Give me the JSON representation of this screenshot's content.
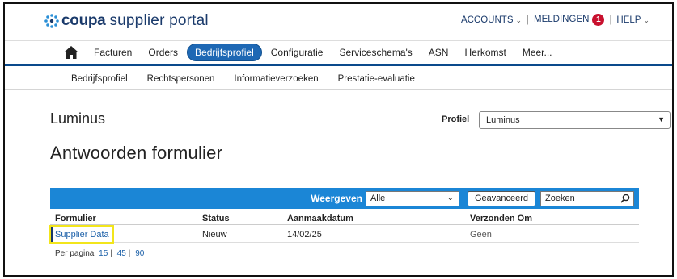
{
  "header": {
    "logo_brand": "coupa",
    "logo_rest": "supplier portal",
    "accounts": "ACCOUNTS",
    "meldingen": "MELDINGEN",
    "meldingen_count": "1",
    "help": "HELP"
  },
  "mainnav": {
    "items": [
      "Facturen",
      "Orders",
      "Bedrijfsprofiel",
      "Configuratie",
      "Serviceschema's",
      "ASN",
      "Herkomst",
      "Meer..."
    ],
    "active": "Bedrijfsprofiel"
  },
  "subnav": {
    "items": [
      "Bedrijfsprofiel",
      "Rechtspersonen",
      "Informatieverzoeken",
      "Prestatie-evaluatie"
    ]
  },
  "supplier_name": "Luminus",
  "profiel": {
    "label": "Profiel",
    "value": "Luminus"
  },
  "page_heading": "Antwoorden formulier",
  "toolbar": {
    "weergeven_label": "Weergeven",
    "weergeven_value": "Alle",
    "advanced_button": "Geavanceerd",
    "search_placeholder": "Zoeken"
  },
  "table": {
    "columns": [
      "Formulier",
      "Status",
      "Aanmaakdatum",
      "Verzonden Om"
    ],
    "rows": [
      {
        "formulier": "Supplier Data",
        "status": "Nieuw",
        "aanmaakdatum": "14/02/25",
        "verzonden_om": "Geen"
      }
    ]
  },
  "pagination": {
    "label": "Per pagina",
    "options": [
      "15",
      "45",
      "90"
    ]
  },
  "colors": {
    "brand_navy": "#1a3a6b",
    "toolbar_blue": "#1b86d6",
    "active_tab": "#1e68b4",
    "badge_red": "#c8102e",
    "highlight_yellow": "#f2e51b"
  }
}
